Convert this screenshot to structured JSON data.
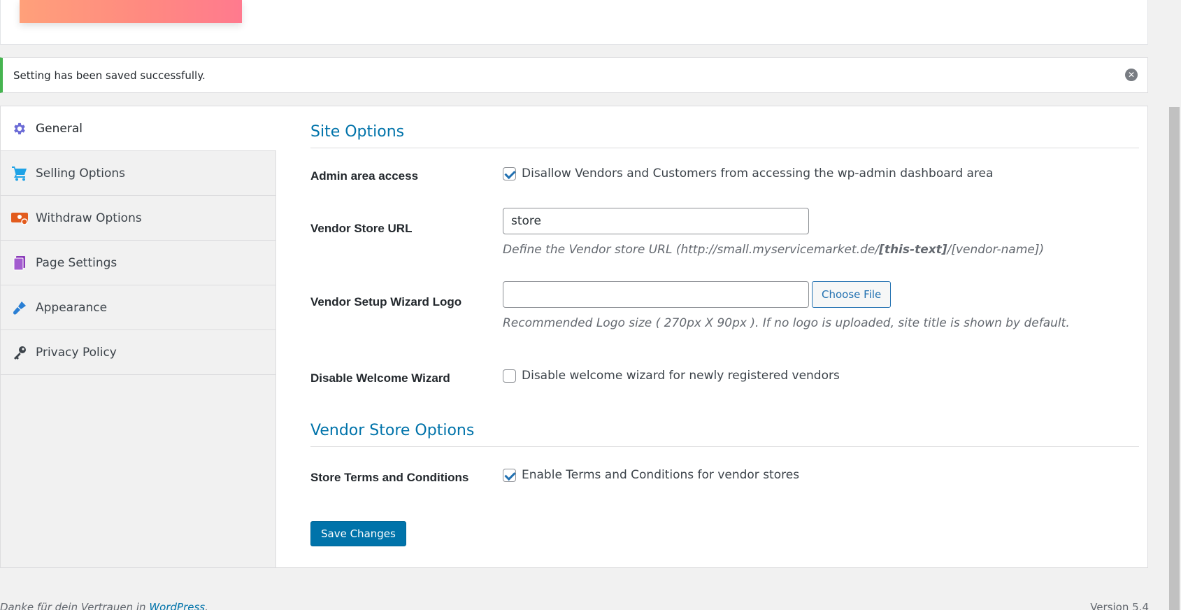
{
  "notice": {
    "message": "Setting has been saved successfully.",
    "dismiss_glyph": "✕"
  },
  "nav": {
    "items": [
      {
        "label": "General",
        "icon": "gear-icon",
        "color": "#6b6bd6"
      },
      {
        "label": "Selling Options",
        "icon": "cart-icon",
        "color": "#1ea2e6"
      },
      {
        "label": "Withdraw Options",
        "icon": "withdraw-icon",
        "color": "#e25b1d"
      },
      {
        "label": "Page Settings",
        "icon": "pages-icon",
        "color": "#8a3ab9"
      },
      {
        "label": "Appearance",
        "icon": "brush-icon",
        "color": "#2a7fd4"
      },
      {
        "label": "Privacy Policy",
        "icon": "key-icon",
        "color": "#3c434a"
      }
    ]
  },
  "site_options": {
    "title": "Site Options",
    "admin_access": {
      "label": "Admin area access",
      "checkbox_text": "Disallow Vendors and Customers from accessing the wp-admin dashboard area",
      "checked": true
    },
    "store_url": {
      "label": "Vendor Store URL",
      "value": "store",
      "desc_prefix": "Define the Vendor store URL (http://small.myservicemarket.de/",
      "desc_bold": "[this-text]",
      "desc_suffix": "/[vendor-name])"
    },
    "wizard_logo": {
      "label": "Vendor Setup Wizard Logo",
      "value": "",
      "button": "Choose File",
      "desc": "Recommended Logo size ( 270px X 90px ). If no logo is uploaded, site title is shown by default."
    },
    "welcome_wizard": {
      "label": "Disable Welcome Wizard",
      "checkbox_text": "Disable welcome wizard for newly registered vendors",
      "checked": false
    }
  },
  "vendor_store_options": {
    "title": "Vendor Store Options",
    "terms": {
      "label": "Store Terms and Conditions",
      "checkbox_text": "Enable Terms and Conditions for vendor stores",
      "checked": true
    }
  },
  "save_button": "Save Changes",
  "footer": {
    "thanks_text": "Danke für dein Vertrauen in ",
    "link_text": "WordPress",
    "suffix": ".",
    "version": "Version 5.4"
  }
}
